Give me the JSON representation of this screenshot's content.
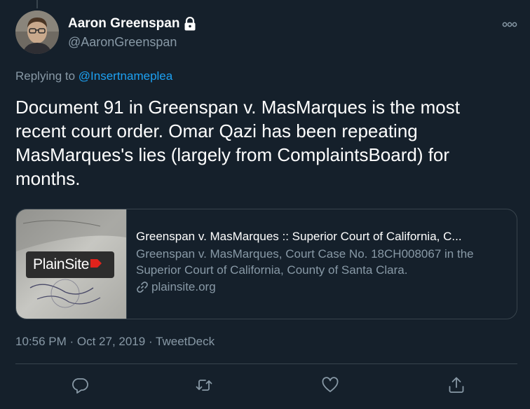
{
  "author": {
    "display_name": "Aaron Greenspan",
    "handle": "@AaronGreenspan",
    "protected_icon": "lock-icon"
  },
  "reply": {
    "prefix": "Replying to ",
    "mention": "@Insertnameplea"
  },
  "tweet": {
    "text": "Document 91 in Greenspan v. MasMarques is the most recent court order. Omar Qazi has been repeating MasMarques's lies (largely from ComplaintsBoard) for months."
  },
  "card": {
    "title": "Greenspan v. MasMarques :: Superior Court of California, C...",
    "description": "Greenspan v. MasMarques, Court Case No. 18CH008067 in the Superior Court of California, County of Santa Clara.",
    "domain": "plainsite.org",
    "thumb_logo": "PlainSite"
  },
  "meta": {
    "text": "10:56 PM · Oct 27, 2019 · TweetDeck"
  },
  "actions": [
    "reply-icon",
    "retweet-icon",
    "like-icon",
    "share-icon"
  ],
  "colors": {
    "background": "#15202b",
    "secondary_text": "#8899a6",
    "link": "#1da1f2",
    "border": "#38444d",
    "logo_red": "#e0231c"
  }
}
